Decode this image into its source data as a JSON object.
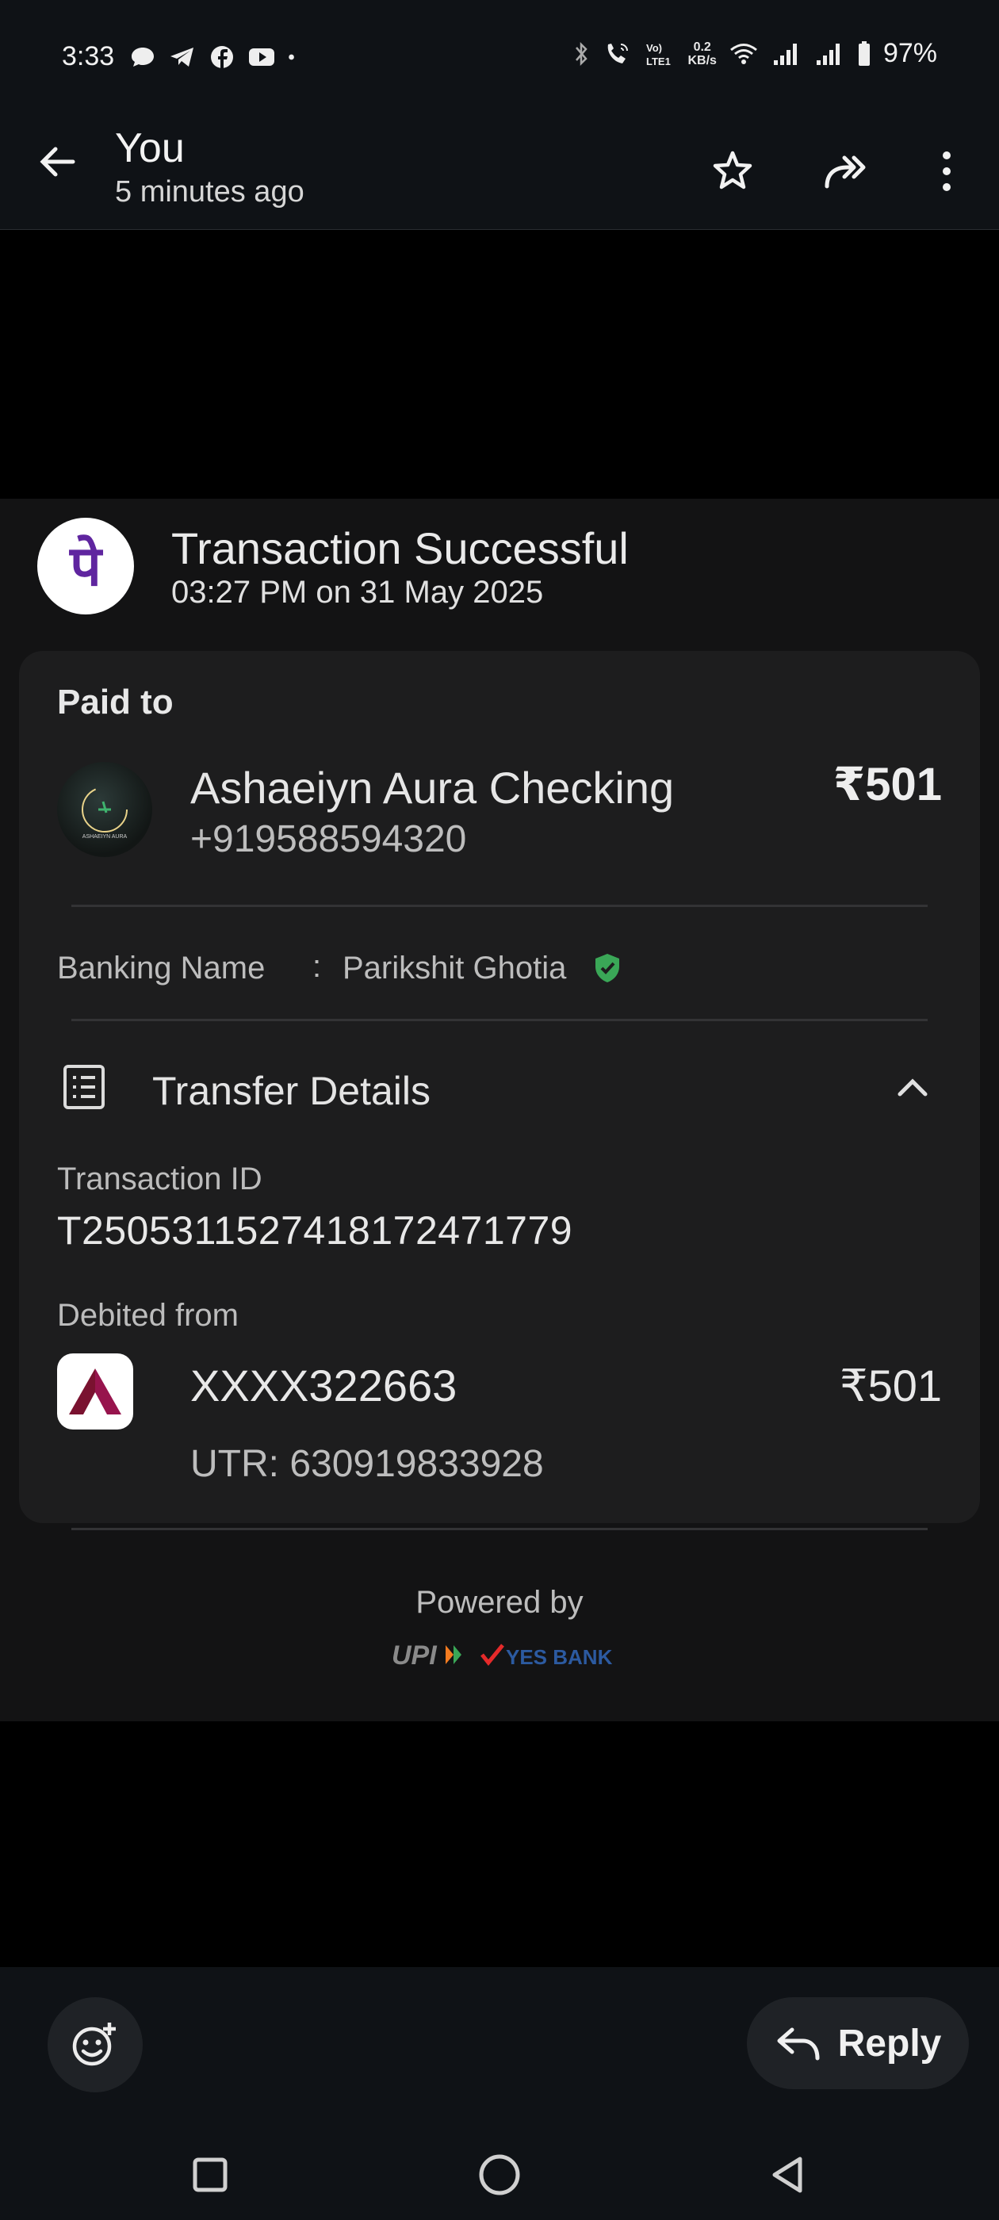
{
  "status_bar": {
    "time": "3:33",
    "net_speed_top": "0.2",
    "net_speed_bottom": "KB/s",
    "battery": "97%",
    "left_icons": [
      "message-icon",
      "telegram-icon",
      "facebook-icon",
      "youtube-icon",
      "dot-icon"
    ],
    "right_icons": [
      "bluetooth-icon",
      "call-icon",
      "volte-icon",
      "wifi-icon",
      "signal-icon",
      "signal-icon",
      "battery-icon"
    ]
  },
  "app_bar": {
    "title": "You",
    "subtitle": "5 minutes ago",
    "actions": [
      "star-icon",
      "forward-icon",
      "more-vert-icon"
    ]
  },
  "receipt": {
    "app_logo_glyph": "पे",
    "title": "Transaction Successful",
    "datetime": "03:27 PM on 31 May 2025",
    "paid_to_label": "Paid to",
    "payee_name": "Ashaeiyn Aura Checking",
    "payee_phone": "+919588594320",
    "amount": "₹501",
    "banking_name_label": "Banking Name",
    "banking_colon": ":",
    "banking_name_value": "Parikshit Ghotia",
    "transfer_details_label": "Transfer Details",
    "transaction_id_label": "Transaction ID",
    "transaction_id": "T2505311527418172471779",
    "debited_from_label": "Debited from",
    "account_number": "XXXX322663",
    "debited_amount": "₹501",
    "utr": "UTR: 630919833928",
    "powered_by": "Powered by",
    "partner_upi": "UPI",
    "partner_bank": "YES BANK"
  },
  "bottom_bar": {
    "reply_label": "Reply"
  },
  "colors": {
    "background": "#000000",
    "bar": "#0f1216",
    "card": "#1d1d1e",
    "phonepe_purple": "#5f259f",
    "verified_green": "#3aa757",
    "axis_red": "#97144d",
    "yes_bank_blue": "#2c5aa0"
  }
}
